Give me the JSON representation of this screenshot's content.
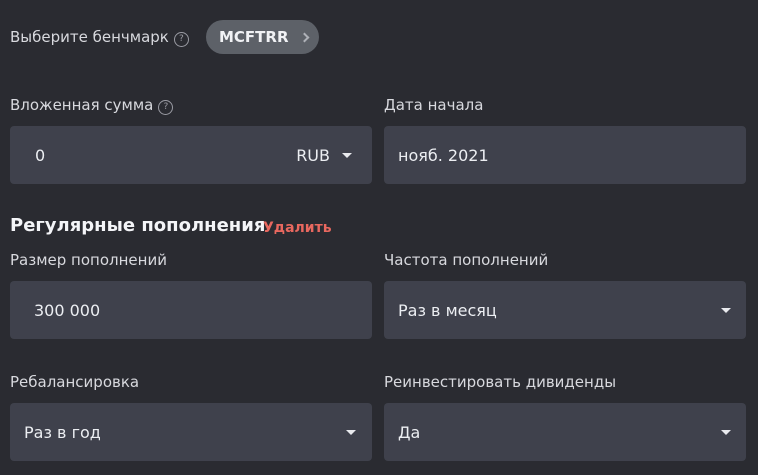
{
  "benchmark": {
    "label": "Выберите бенчмарк",
    "help_icon": "?",
    "value": "MCFTRR"
  },
  "investment": {
    "label": "Вложенная сумма",
    "help_icon": "?",
    "value": "0",
    "currency": "RUB"
  },
  "start_date": {
    "label": "Дата начала",
    "value": "нояб. 2021"
  },
  "regular": {
    "title": "Регулярные пополнения",
    "delete_label": "Удалить",
    "size_label": "Размер пополнений",
    "size_value": "300 000",
    "frequency_label": "Частота пополнений",
    "frequency_value": "Раз в месяц"
  },
  "rebalancing": {
    "label": "Ребалансировка",
    "value": "Раз в год"
  },
  "dividends": {
    "label": "Реинвестировать дивиденды",
    "value": "Да"
  },
  "colors": {
    "background": "#2a2b31",
    "field": "#3f414c",
    "chip": "#5d6168",
    "danger": "#e9685f"
  }
}
